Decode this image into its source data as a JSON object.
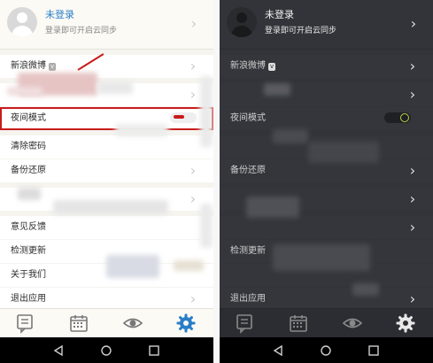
{
  "light": {
    "header": {
      "user_name": "未登录",
      "user_sub": "登录即可开启云同步"
    },
    "menu": {
      "weibo": "新浪微博",
      "night_mode": "夜间模式",
      "clear_password": "清除密码",
      "backup_restore": "备份还原",
      "feedback": "意见反馈",
      "check_update": "检测更新",
      "about": "关于我们",
      "exit_app": "退出应用"
    }
  },
  "dark": {
    "header": {
      "user_name": "未登录",
      "user_sub": "登录即可开启云同步"
    },
    "menu": {
      "weibo": "新浪微博",
      "night_mode": "夜间模式",
      "backup_restore": "备份还原",
      "check_update": "检测更新",
      "exit_app": "退出应用"
    }
  },
  "badges": {
    "weibo_badge": "v"
  },
  "icons": {
    "chevron": "›",
    "tab1": "notes-icon",
    "tab2": "calendar-icon",
    "tab3": "eye-icon",
    "tab4": "gear-icon"
  },
  "colors": {
    "accent_blue": "#2a7ec8",
    "highlight_red": "#c81b1b",
    "toggle_green": "#b6d84a"
  }
}
